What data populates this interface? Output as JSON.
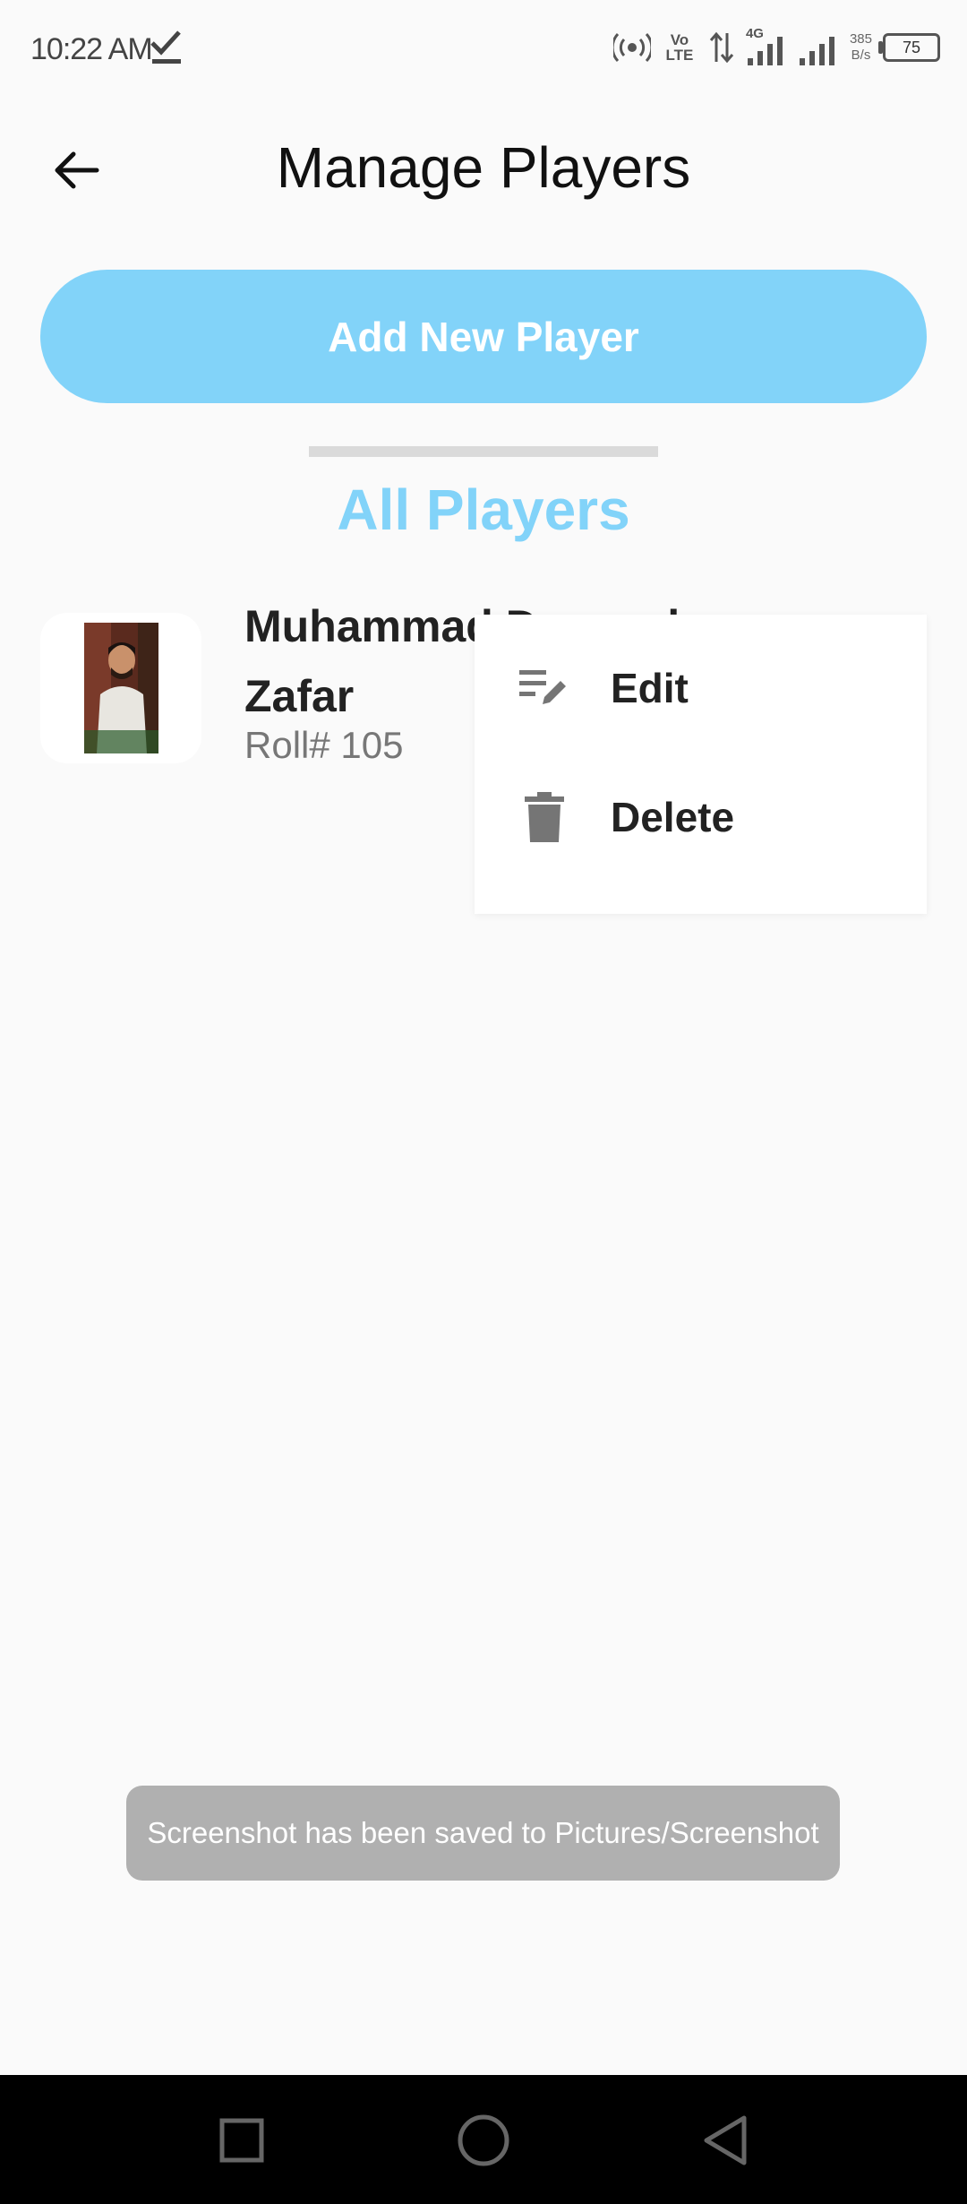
{
  "status_bar": {
    "time": "10:22 AM",
    "network_speed_value": "385",
    "network_speed_unit": "B/s",
    "battery_level": "75",
    "icons": [
      "download-complete-icon",
      "hotspot-icon",
      "volte-icon",
      "data-transfer-icon",
      "signal-4g-icon",
      "signal-icon",
      "battery-icon"
    ],
    "volte_text": "Vo\nLTE",
    "network_type": "4G"
  },
  "header": {
    "title": "Manage Players",
    "back_icon": "arrow-left-icon"
  },
  "add_button": {
    "label": "Add New Player",
    "color": "#82d3f9"
  },
  "section": {
    "title": "All Players",
    "color": "#82d3f9"
  },
  "players": [
    {
      "name": "Muhammad Dawood Zafar",
      "roll": "Roll# 105"
    }
  ],
  "context_menu": {
    "items": [
      {
        "label": "Edit",
        "icon": "edit-note-icon"
      },
      {
        "label": "Delete",
        "icon": "trash-icon"
      }
    ]
  },
  "toast": {
    "text": "Screenshot has been saved to  Pictures/Screenshot"
  },
  "nav_bar": {
    "icons": [
      "recents-square-icon",
      "home-circle-icon",
      "back-triangle-icon"
    ]
  }
}
